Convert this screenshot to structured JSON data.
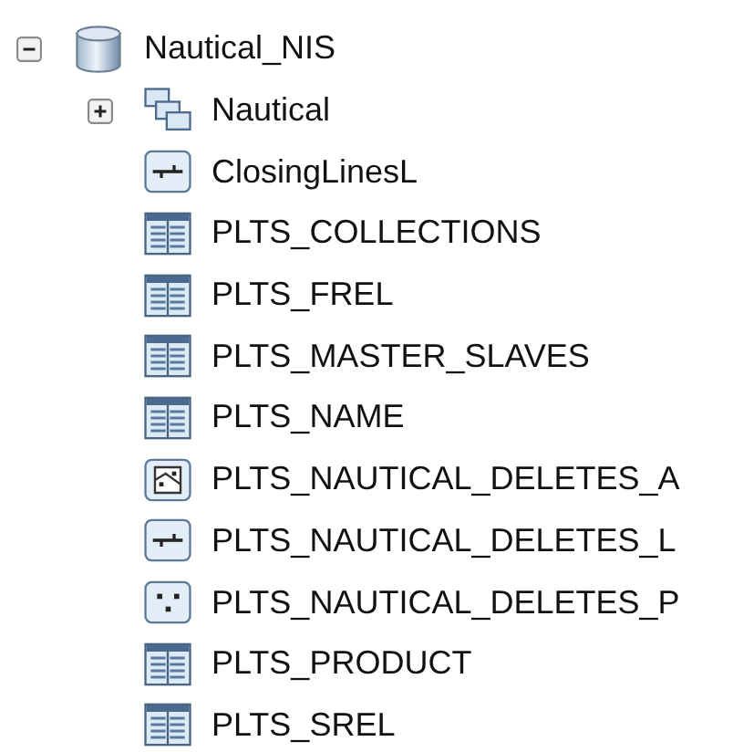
{
  "tree": {
    "label": "Nautical_NIS",
    "kind": "database",
    "expanded": true,
    "children": [
      {
        "label": "Nautical",
        "kind": "dataset",
        "expanded": false
      },
      {
        "label": "ClosingLinesL",
        "kind": "line"
      },
      {
        "label": "PLTS_COLLECTIONS",
        "kind": "table"
      },
      {
        "label": "PLTS_FREL",
        "kind": "table"
      },
      {
        "label": "PLTS_MASTER_SLAVES",
        "kind": "table"
      },
      {
        "label": "PLTS_NAME",
        "kind": "table"
      },
      {
        "label": "PLTS_NAUTICAL_DELETES_A",
        "kind": "polygon"
      },
      {
        "label": "PLTS_NAUTICAL_DELETES_L",
        "kind": "line"
      },
      {
        "label": "PLTS_NAUTICAL_DELETES_P",
        "kind": "point"
      },
      {
        "label": "PLTS_PRODUCT",
        "kind": "table"
      },
      {
        "label": "PLTS_SREL",
        "kind": "table"
      }
    ]
  }
}
